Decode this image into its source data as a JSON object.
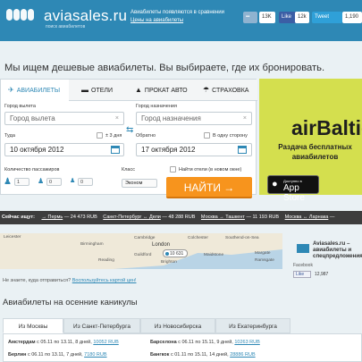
{
  "header": {
    "logo": "aviasales.ru",
    "logo_sub": "поиск авиабилетов",
    "tagline": "Авиабилеты появляются в сравнении",
    "tagline_link": "Цены на авиабилеты",
    "social": {
      "vk_count": "13K",
      "fb_label": "Like",
      "fb_count": "12k",
      "tw_label": "Tweet",
      "tw_count": "1,190"
    }
  },
  "headline": "Мы ищем дешевые авиабилеты. Вы выбираете, где их бронировать.",
  "search": {
    "tabs": [
      {
        "label": "Авиабилеты",
        "icon": "plane-icon"
      },
      {
        "label": "Отели",
        "icon": "bed-icon"
      },
      {
        "label": "Прокат авто",
        "icon": "car-icon"
      },
      {
        "label": "Страховка",
        "icon": "umbrella-icon"
      }
    ],
    "origin_label": "Город вылета",
    "origin_placeholder": "Город вылета",
    "dest_label": "Город назначения",
    "dest_placeholder": "Город назначения",
    "depart_label": "Туда",
    "flex_label": "± 3 дня",
    "depart_value": "10 октября 2012",
    "return_label": "Обратно",
    "oneway_label": "В одну сторону",
    "return_value": "17 октября 2012",
    "pax_label": "Количество пассажиров",
    "pax": [
      "1",
      "0",
      "0"
    ],
    "class_label": "Класс",
    "class_value": "Эконом",
    "hotel_label": "Найти отели (в новом окне)",
    "submit": "НАЙТИ →"
  },
  "ad": {
    "logo": "airBaltic",
    "text": "Раздача бесплатных авиабилетов",
    "appstore_small": "Доступно в",
    "appstore_big": "App Store"
  },
  "ticker": {
    "label": "Сейчас ищут:",
    "items": [
      {
        "route": "→ Пермь",
        "price": "— 24 473 RUB"
      },
      {
        "route": "Санкт-Петербург ↔ Дели",
        "price": "— 48 288 RUB"
      },
      {
        "route": "Москва → Ташкент",
        "price": "— 11 193 RUB"
      },
      {
        "route": "Москва ↔ Ларнака",
        "price": "—"
      }
    ]
  },
  "map": {
    "labels": [
      "Leicester",
      "Birmingham",
      "Cambridge",
      "London",
      "Colchester",
      "Guildford",
      "Southend-on-Sea",
      "Reading",
      "Brighton",
      "Maidstone",
      "Margate",
      "Ramsgate"
    ],
    "pin": "10 631",
    "note": "Не знаете, куда отправиться?",
    "note_link": "Воспользуйтесь картой цен!"
  },
  "fb": {
    "title": "Aviasales.ru – авиабилеты и спецпредложения",
    "sub": "Facebook",
    "like": "Like",
    "count": "12,987"
  },
  "vacations": {
    "title": "Авиабилеты на осенние каникулы",
    "tabs": [
      "Из Москвы",
      "Из Санкт-Петербурга",
      "Из Новосибирска",
      "Из Екатеринбурга"
    ],
    "rows": [
      {
        "city": "Амстердам",
        "text": "с 05.11 по 13.11, 8 дней,",
        "price": "10052 RUB"
      },
      {
        "city": "Барселона",
        "text": "с 06.11 по 15.11, 9 дней,",
        "price": "10263 RUB"
      },
      {
        "city": "Берлин",
        "text": "с 06.11 по 13.11, 7 дней,",
        "price": "7180 RUB"
      },
      {
        "city": "Бангкок",
        "text": "с 01.11 по 15.11, 14 дней,",
        "price": "28886 RUB"
      }
    ]
  }
}
